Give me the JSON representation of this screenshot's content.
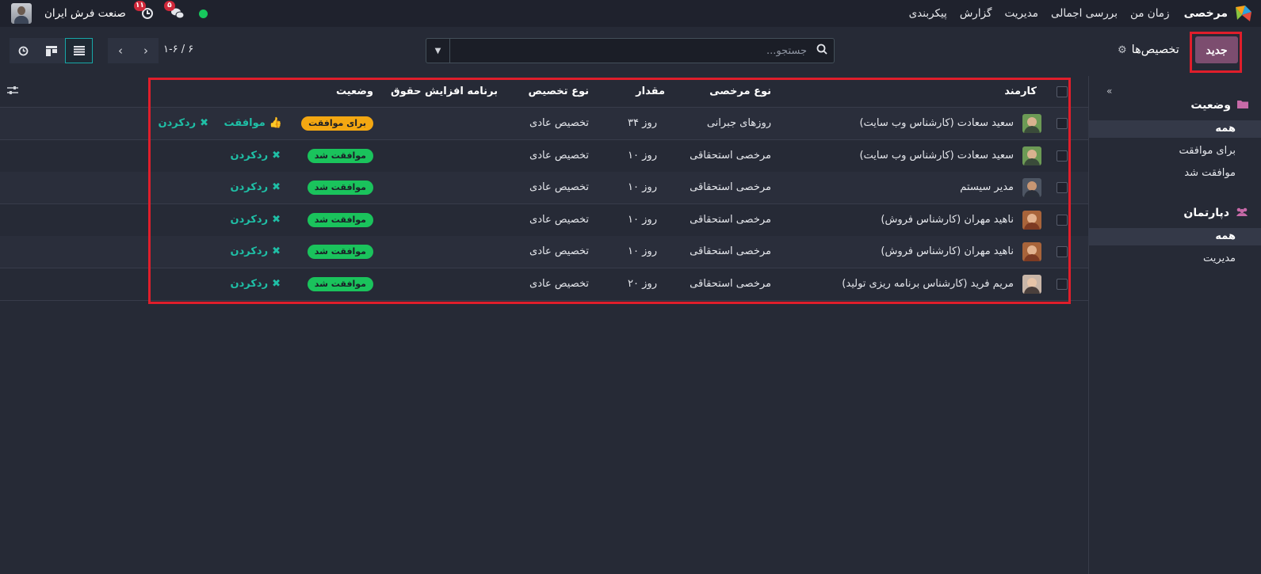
{
  "navbar": {
    "app_title": "مرخصی",
    "menu": [
      "زمان من",
      "بررسی اجمالی",
      "مدیریت",
      "گزارش",
      "پیکربندی"
    ],
    "company": "صنعت فرش ایران",
    "activity_count": "۱۱",
    "messages_count": "۵",
    "colors": {
      "online": "#17c85d",
      "badge": "#d0283a"
    }
  },
  "control_panel": {
    "new_label": "جدید",
    "title": "تخصیص‌ها",
    "search_placeholder": "جستجو...",
    "pager_value": "۱-۶ / ۶"
  },
  "side_panel": {
    "status": {
      "title": "وضعیت",
      "items": [
        "همه",
        "برای موافقت",
        "موافقت شد"
      ],
      "active": "همه"
    },
    "department": {
      "title": "دپارتمان",
      "items": [
        "همه",
        "مدیریت"
      ],
      "active": "همه"
    }
  },
  "list": {
    "headers": {
      "employee": "کارمند",
      "leave_type": "نوع مرخصی",
      "amount": "مقدار",
      "allocation_type": "نوع تخصیص",
      "accrual_plan": "برنامه افزایش حقوق",
      "status": "وضعیت"
    },
    "actions": {
      "approve": "موافقت",
      "refuse": "ردکردن"
    },
    "rows": [
      {
        "employee": "سعید سعادت (کارشناس وب سایت)",
        "leave_type": "روزهای جبرانی",
        "amount": "۳۴ روز",
        "allocation_type": "تخصیص عادی",
        "status": "برای موافقت",
        "status_color": "#f3a712",
        "can_approve": true,
        "avatar": "male-green"
      },
      {
        "employee": "سعید سعادت (کارشناس وب سایت)",
        "leave_type": "مرخصی استحقاقی",
        "amount": "۱۰ روز",
        "allocation_type": "تخصیص عادی",
        "status": "موافقت شد",
        "status_color": "#1ac35c",
        "can_approve": false,
        "avatar": "male-green"
      },
      {
        "employee": "مدیر سیستم",
        "leave_type": "مرخصی استحقاقی",
        "amount": "۱۰ روز",
        "allocation_type": "تخصیص عادی",
        "status": "موافقت شد",
        "status_color": "#1ac35c",
        "can_approve": false,
        "avatar": "male-dark"
      },
      {
        "employee": "ناهید مهران (کارشناس فروش)",
        "leave_type": "مرخصی استحقاقی",
        "amount": "۱۰ روز",
        "allocation_type": "تخصیص عادی",
        "status": "موافقت شد",
        "status_color": "#1ac35c",
        "can_approve": false,
        "avatar": "female-red"
      },
      {
        "employee": "ناهید مهران (کارشناس فروش)",
        "leave_type": "مرخصی استحقاقی",
        "amount": "۱۰ روز",
        "allocation_type": "تخصیص عادی",
        "status": "موافقت شد",
        "status_color": "#1ac35c",
        "can_approve": false,
        "avatar": "female-red"
      },
      {
        "employee": "مریم فرید (کارشناس برنامه ریزی تولید)",
        "leave_type": "مرخصی استحقاقی",
        "amount": "۲۰ روز",
        "allocation_type": "تخصیص عادی",
        "status": "موافقت شد",
        "status_color": "#1ac35c",
        "can_approve": false,
        "avatar": "female-light"
      }
    ]
  }
}
